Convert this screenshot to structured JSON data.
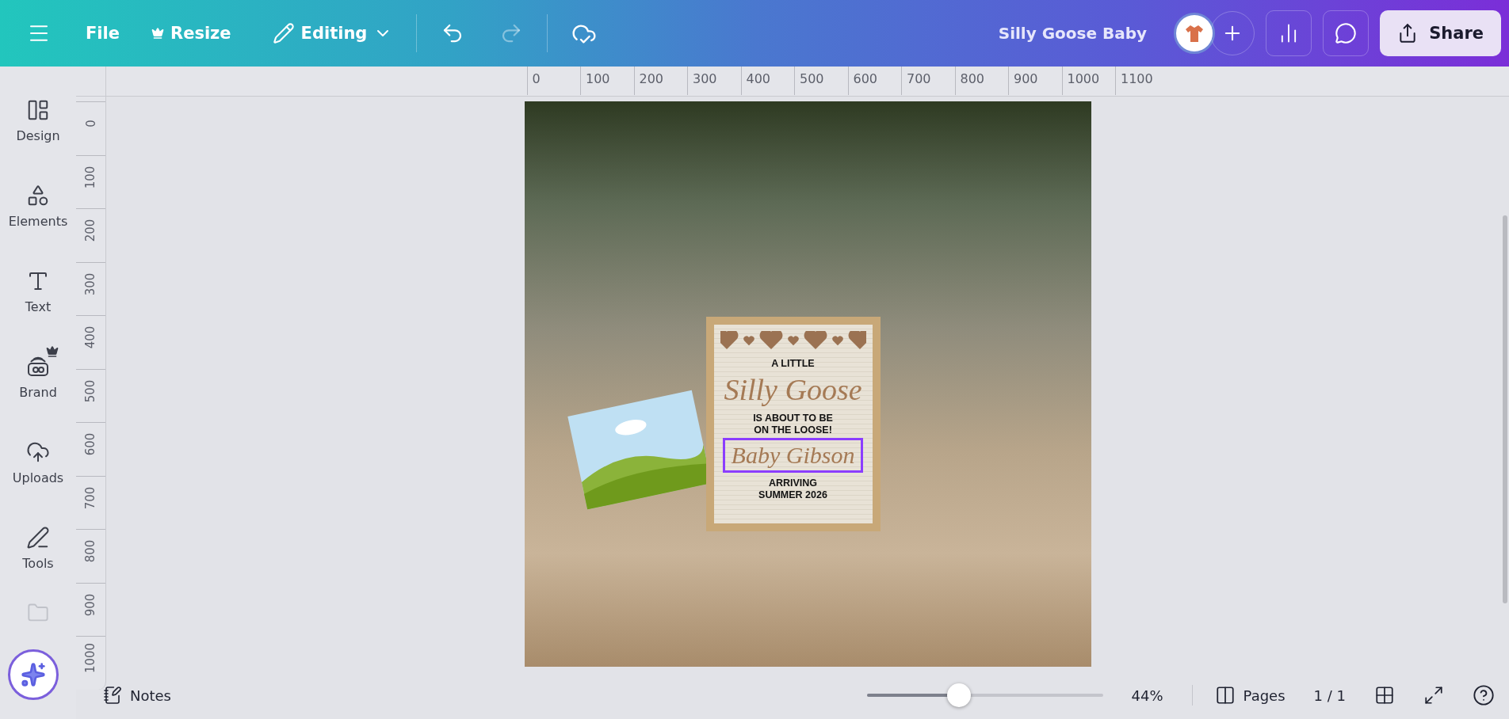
{
  "topbar": {
    "file": "File",
    "resize": "Resize",
    "mode": "Editing",
    "undo": {
      "disabled": false
    },
    "redo": {
      "disabled": true
    },
    "title": "Silly Goose Baby",
    "share": "Share"
  },
  "sidebar": {
    "items": [
      {
        "label": "Design"
      },
      {
        "label": "Elements"
      },
      {
        "label": "Text"
      },
      {
        "label": "Brand"
      },
      {
        "label": "Uploads"
      },
      {
        "label": "Tools"
      }
    ]
  },
  "rulers": {
    "horizontal": [
      "0",
      "100",
      "200",
      "300",
      "400",
      "500",
      "600",
      "700",
      "800",
      "900",
      "1000",
      "1100"
    ],
    "vertical": [
      "0",
      "100",
      "200",
      "300",
      "400",
      "500",
      "600",
      "700",
      "800",
      "900",
      "1000"
    ]
  },
  "design": {
    "board": {
      "top": "A LITTLE",
      "script": "Silly Goose",
      "middle": [
        "IS ABOUT TO BE",
        "ON THE LOOSE!"
      ],
      "name": {
        "text": "Baby Gibson",
        "selected": true
      },
      "bottom": [
        "ARRIVING",
        "SUMMER 2026"
      ]
    }
  },
  "bottombar": {
    "notes": "Notes",
    "zoom": {
      "level": 0.39,
      "reading": "44%"
    },
    "pages": "Pages",
    "page_count": "1 / 1"
  }
}
